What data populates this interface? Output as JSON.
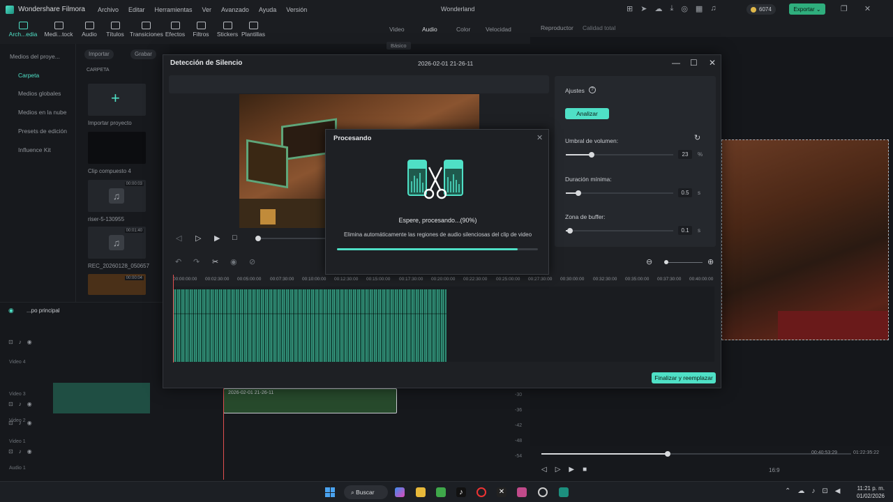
{
  "app": {
    "name": "Wondershare Filmora",
    "project_title": "Wonderland",
    "menu": [
      "Archivo",
      "Editar",
      "Herramientas",
      "Ver",
      "Avanzado",
      "Ayuda",
      "Versión"
    ],
    "credits": "6074",
    "export_label": "Exportar"
  },
  "toolbar": {
    "items": [
      "Arch...edia",
      "Medi...tock",
      "Audio",
      "Títulos",
      "Transiciones",
      "Efectos",
      "Filtros",
      "Stickers",
      "Plantillas"
    ]
  },
  "left_nav": {
    "items": [
      "Medios del proye...",
      "Carpeta",
      "Medios globales",
      "Medios en la nube",
      "Presets de edición",
      "Influence Kit"
    ]
  },
  "media": {
    "import_label": "Importar",
    "record_label": "Grabar",
    "folder_label": "CARPETA",
    "items": [
      {
        "label": "Importar proyecto",
        "duration": ""
      },
      {
        "label": "Clip compuesto 4",
        "duration": ""
      },
      {
        "label": "riser-5-130955",
        "duration": "00:00:03"
      },
      {
        "label": "REC_20260128_050657",
        "duration": "00:01:40"
      },
      {
        "label": "",
        "duration": "00:00:04"
      }
    ]
  },
  "properties": {
    "tabs": [
      "Video",
      "Audio",
      "Color",
      "Velocidad"
    ],
    "subtab": "Básico"
  },
  "player": {
    "label": "Reproductor",
    "quality": "Calidad total",
    "current_time": "00:40:53:29",
    "total_time": "01:22:35:22",
    "ratio": "16:9"
  },
  "timeline": {
    "track_name": "...po principal",
    "tracks": [
      "Video 4",
      "Video 3",
      "Video 2",
      "Video 1",
      "Audio 1"
    ],
    "clip_name": "2026-02-01 21-26-11",
    "db_marks": [
      "-30",
      "-36",
      "-42",
      "-48",
      "-54"
    ]
  },
  "modal": {
    "title": "Detección de Silencio",
    "date": "2026-02-01 21-26-11",
    "settings_title": "Ajustes",
    "analyze_label": "Analizar",
    "volume_label": "Umbral de volumen:",
    "volume_value": "23",
    "volume_unit": "%",
    "duration_label": "Duración mínima:",
    "duration_value": "0.5",
    "duration_unit": "s",
    "buffer_label": "Zona de buffer:",
    "buffer_value": "0.1",
    "buffer_unit": "s",
    "finish_label": "Finalizar y reemplazar",
    "ruler": [
      "00:00:00:00",
      "00:02:30:00",
      "00:05:00:00",
      "00:07:30:00",
      "00:10:00:00",
      "00:12:30:00",
      "00:15:00:00",
      "00:17:30:00",
      "00:20:00:00",
      "00:22:30:00",
      "00:25:00:00",
      "00:27:30:00",
      "00:30:00:00",
      "00:32:30:00",
      "00:35:00:00",
      "00:37:30:00",
      "00:40:00:00"
    ]
  },
  "processing": {
    "title": "Procesando",
    "status": "Espere, procesando...(90%)",
    "description": "Elimina automáticamente las regiones de audio silenciosas del clip de video",
    "progress": 0.9
  },
  "taskbar": {
    "search_label": "Buscar",
    "time": "11:21 p. m.",
    "date": "01/02/2026"
  }
}
